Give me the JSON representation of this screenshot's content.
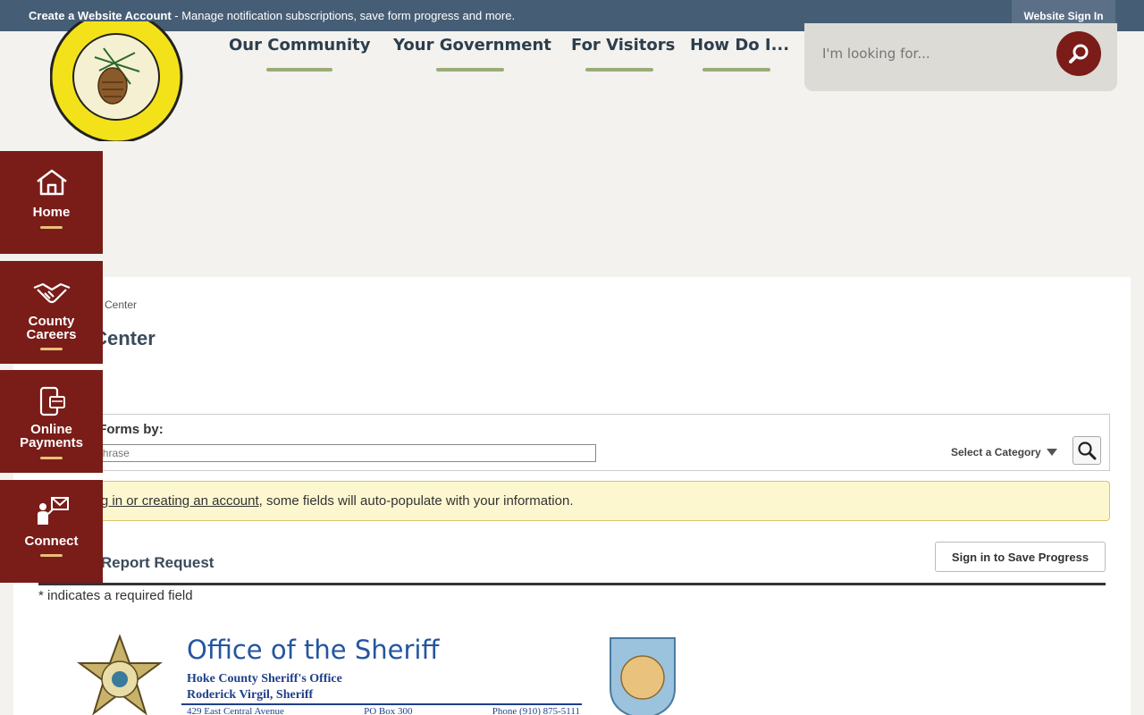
{
  "topbar": {
    "create_bold": "Create a Website Account",
    "create_rest": " - Manage notification subscriptions, save form progress and more.",
    "signin": "Website Sign In"
  },
  "nav": {
    "items": [
      {
        "label": "Our Community"
      },
      {
        "label": "Your Government"
      },
      {
        "label": "For Visitors"
      },
      {
        "label": "How Do I..."
      }
    ]
  },
  "search": {
    "placeholder": "I'm looking for..."
  },
  "sidebar": {
    "items": [
      {
        "label": "Home"
      },
      {
        "label": "County Careers"
      },
      {
        "label": "Online Payments"
      },
      {
        "label": "Connect"
      }
    ]
  },
  "main": {
    "breadcrumb": "Home › Form Center",
    "title": "Form Center",
    "search_label": "Search Forms by:",
    "search_placeholder": "Word or Phrase",
    "category": "Select a Category",
    "notice_link": "By signing in or creating an account",
    "notice_rest": ", some fields will auto-populate with your information.",
    "form_title": "Incident Report Request",
    "save_button": "Sign in to Save Progress",
    "required_note": "* indicates a required field"
  },
  "letterhead": {
    "title": "Office of the Sheriff",
    "line1": "Hoke County Sheriff's Office",
    "line2": "Roderick Virgil, Sheriff",
    "address": "429 East Central Avenue",
    "pobox": "PO Box 300",
    "phone": "Phone (910) 875-5111"
  },
  "colors": {
    "topbar": "#465e75",
    "sidebar": "#7a1c18",
    "nav_underline": "#9aab78"
  }
}
